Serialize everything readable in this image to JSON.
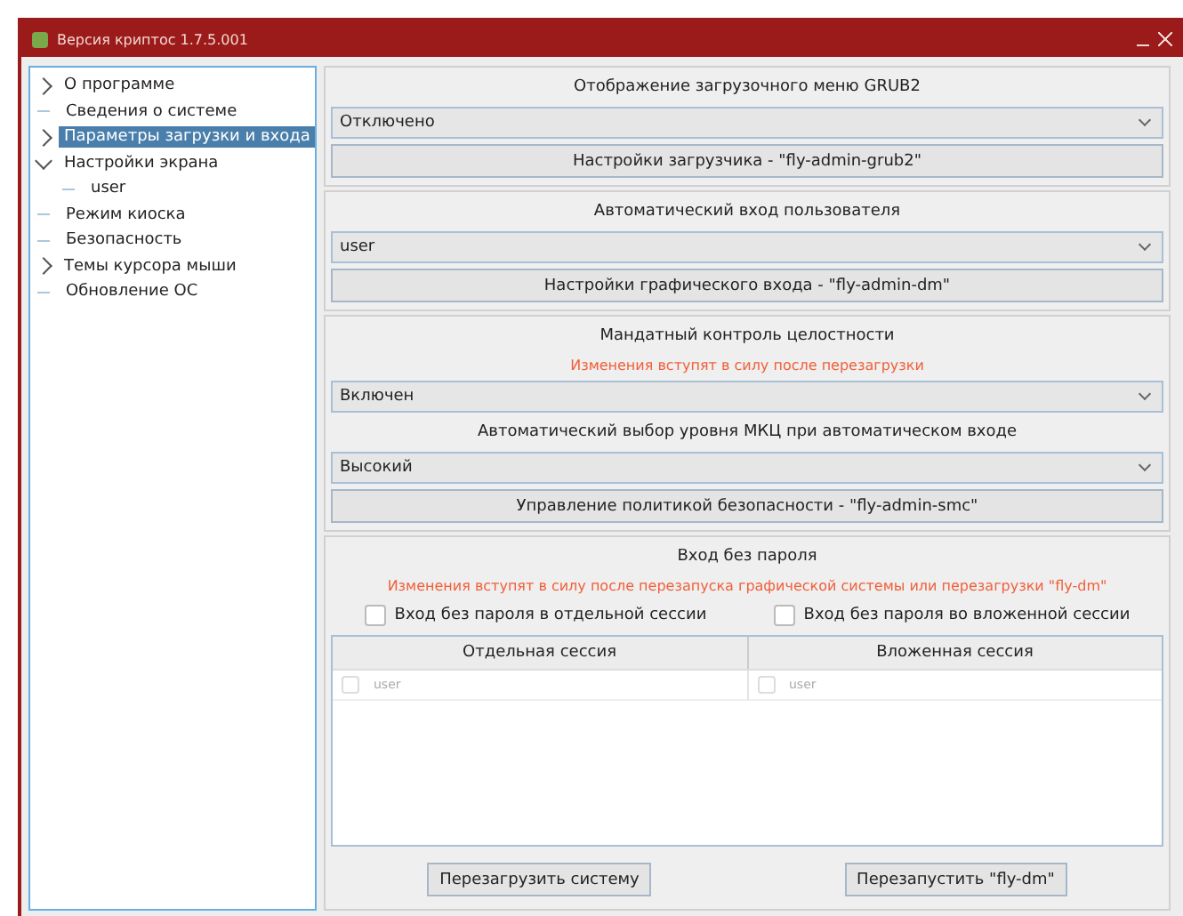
{
  "window": {
    "title": "Версия криптос 1.7.5.001"
  },
  "sidebar": {
    "items": [
      {
        "label": "О программе",
        "expandable": true,
        "expanded": false,
        "selected": false
      },
      {
        "label": "Сведения о системе",
        "expandable": false,
        "selected": false
      },
      {
        "label": "Параметры загрузки и входа",
        "expandable": true,
        "expanded": false,
        "selected": true
      },
      {
        "label": "Настройки экрана",
        "expandable": true,
        "expanded": true,
        "selected": false,
        "children": [
          {
            "label": "user",
            "expandable": false,
            "selected": false
          }
        ]
      },
      {
        "label": "Режим киоска",
        "expandable": false,
        "selected": false
      },
      {
        "label": "Безопасность",
        "expandable": false,
        "selected": false
      },
      {
        "label": "Темы курсора мыши",
        "expandable": true,
        "expanded": false,
        "selected": false
      },
      {
        "label": "Обновление ОС",
        "expandable": false,
        "selected": false
      }
    ]
  },
  "sections": [
    {
      "items": [
        {
          "kind": "label",
          "text": "Отображение загрузочного меню GRUB2"
        },
        {
          "kind": "combo",
          "value": "Отключено"
        },
        {
          "kind": "button",
          "text": "Настройки загрузчика - \"fly-admin-grub2\""
        }
      ]
    },
    {
      "items": [
        {
          "kind": "label",
          "text": "Автоматический вход пользователя"
        },
        {
          "kind": "combo",
          "value": "user"
        },
        {
          "kind": "button",
          "text": "Настройки графического входа - \"fly-admin-dm\""
        }
      ]
    },
    {
      "items": [
        {
          "kind": "label",
          "text": "Мандатный контроль целостности"
        },
        {
          "kind": "warning",
          "text": "Изменения вступят в силу после перезагрузки"
        },
        {
          "kind": "combo",
          "value": "Включен"
        },
        {
          "kind": "label",
          "text": "Автоматический выбор уровня МКЦ при автоматическом входе"
        },
        {
          "kind": "combo",
          "value": "Высокий"
        },
        {
          "kind": "button",
          "text": "Управление политикой безопасности - \"fly-admin-smc\""
        }
      ]
    },
    {
      "items": [
        {
          "kind": "label",
          "text": "Вход без пароля"
        },
        {
          "kind": "warning",
          "text": "Изменения вступят в силу после перезапуска графической системы или перезагрузки \"fly-dm\""
        },
        {
          "kind": "checks",
          "checks": [
            {
              "label": "Вход без пароля в отдельной сессии",
              "checked": false
            },
            {
              "label": "Вход без пароля во вложенной сессии",
              "checked": false
            }
          ]
        },
        {
          "kind": "table",
          "columns": [
            {
              "heading": "Отдельная сессия",
              "rows": [
                {
                  "label": "user",
                  "checked": false
                }
              ]
            },
            {
              "heading": "Вложенная сессия",
              "rows": [
                {
                  "label": "user",
                  "checked": false
                }
              ]
            }
          ]
        },
        {
          "kind": "buttons",
          "buttons": [
            "Перезагрузить систему",
            "Перезапустить \"fly-dm\""
          ]
        }
      ]
    }
  ]
}
